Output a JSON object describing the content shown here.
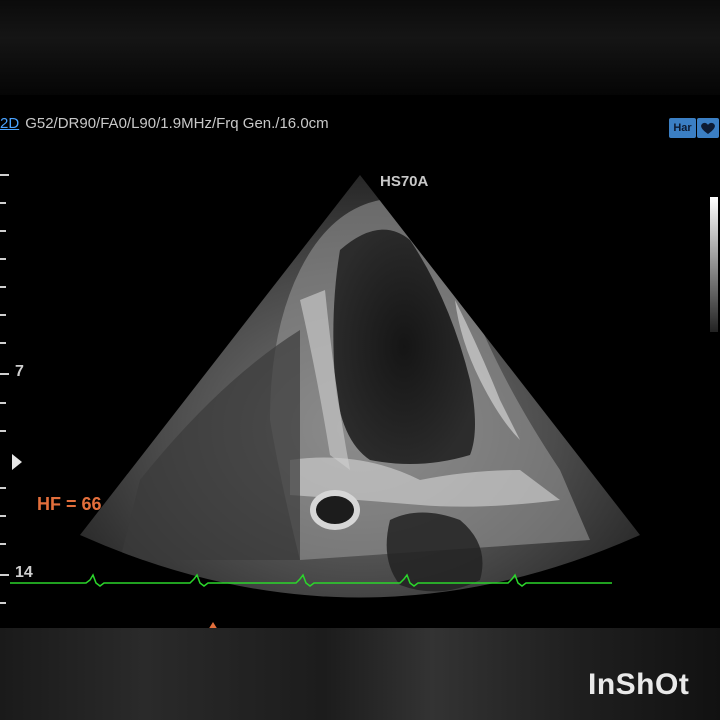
{
  "header": {
    "mode": "2D",
    "parameters": "G52/DR90/FA0/L90/1.9MHz/Frq Gen./16.0cm",
    "probe": "HS70A",
    "badges": {
      "har": "Har",
      "heart_icon": "heart-icon"
    }
  },
  "scale": {
    "depth_labels": [
      {
        "text": "7"
      },
      {
        "text": "14"
      }
    ]
  },
  "overlay": {
    "heart_rate": "HF = 66"
  },
  "ecg": {
    "color": "#2bd62b"
  },
  "watermark": "InShOt",
  "colors": {
    "accent": "#4aa3ff",
    "hr": "#e36f3c",
    "ecg": "#2bd62b"
  }
}
